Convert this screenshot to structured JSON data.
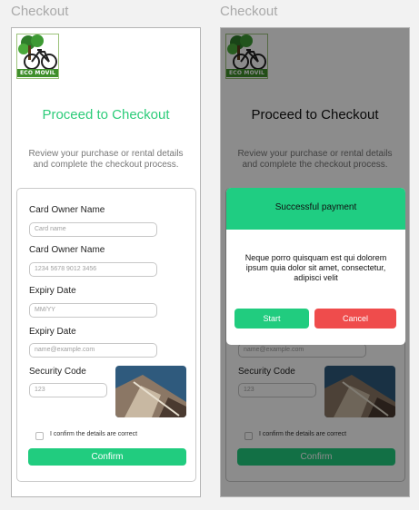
{
  "frames": [
    {
      "title": "Checkout",
      "logo_text": "ECO MOVIL",
      "heading": "Proceed to Checkout",
      "subtitle": "Review your purchase or rental details and complete the checkout process.",
      "form": {
        "card_owner_label_1": "Card Owner Name",
        "card_owner_placeholder_1": "Card name",
        "card_owner_label_2": "Card Owner Name",
        "card_number_placeholder": "1234 5678 9012 3456",
        "expiry_label_1": "Expiry Date",
        "expiry_placeholder": "MM/YY",
        "expiry_label_2": "Expiry Date",
        "email_placeholder": "name@example.com",
        "security_label": "Security Code",
        "security_placeholder": "123",
        "confirm_checkbox_label": "I confirm the details are correct",
        "confirm_button": "Confirm"
      }
    },
    {
      "title": "Checkout",
      "logo_text": "ECO MOVIL",
      "heading": "Proceed to Checkout",
      "subtitle": "Review your purchase or rental details and complete the checkout process.",
      "form": {
        "email_placeholder": "name@example.com",
        "security_label": "Security Code",
        "security_placeholder": "123",
        "confirm_checkbox_label": "I confirm the details are correct",
        "confirm_button": "Confirm"
      },
      "modal": {
        "title": "Successful payment",
        "body": "Neque porro quisquam est qui dolorem ipsum quia dolor sit amet, consectetur, adipisci velit",
        "start_button": "Start",
        "cancel_button": "Cancel"
      }
    }
  ],
  "colors": {
    "accent_green": "#21cc7f",
    "cancel_red": "#ef4c4c"
  }
}
